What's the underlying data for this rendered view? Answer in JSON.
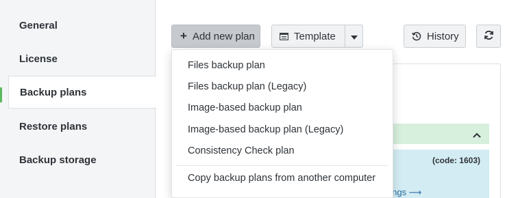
{
  "sidebar": {
    "items": [
      {
        "label": "General"
      },
      {
        "label": "License"
      },
      {
        "label": "Backup plans"
      },
      {
        "label": "Restore plans"
      },
      {
        "label": "Backup storage"
      }
    ]
  },
  "toolbar": {
    "add_label": "Add new plan",
    "template_label": "Template",
    "history_label": "History"
  },
  "dropdown": {
    "items": [
      {
        "label": "Files backup plan"
      },
      {
        "label": "Files backup plan (Legacy)"
      },
      {
        "label": "Image-based backup plan"
      },
      {
        "label": "Image-based backup plan (Legacy)"
      },
      {
        "label": "Consistency Check plan"
      }
    ],
    "copy_label": "Copy backup plans from another computer"
  },
  "panel": {
    "code_text": "(code: 1603)",
    "link_text": "ttings ⟶"
  },
  "colors": {
    "accent_green": "#5cb85c",
    "success_bg": "#d7efdd",
    "info_bg": "#d3ecf3",
    "link": "#2b6ea3"
  }
}
